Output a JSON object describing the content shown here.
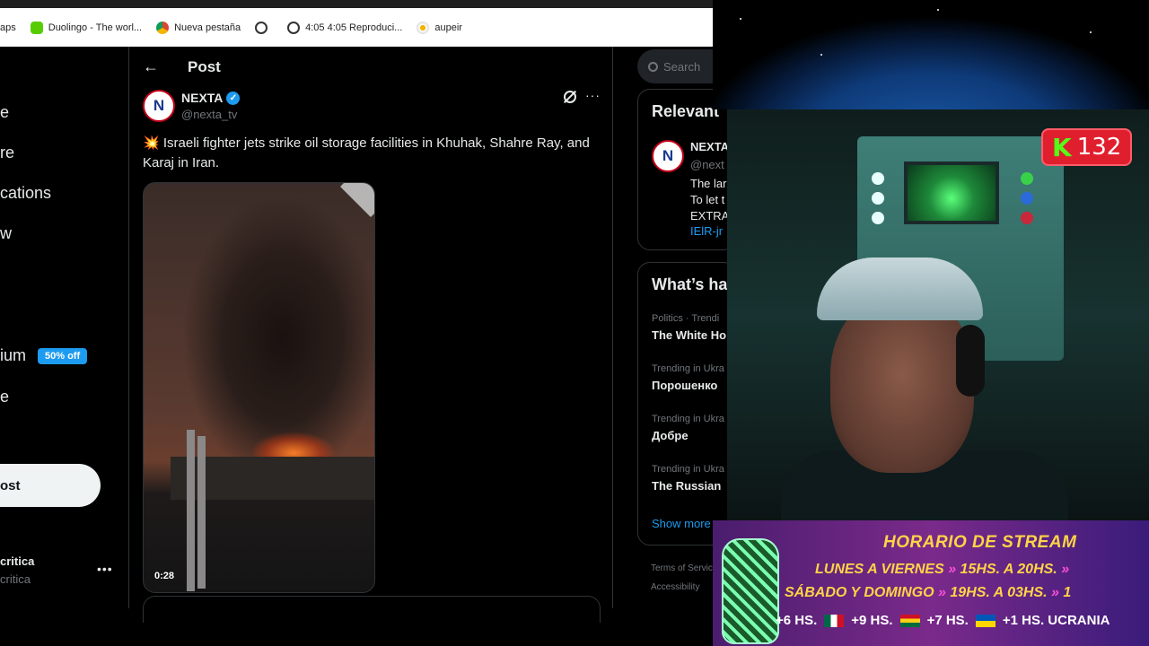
{
  "bookmarks": [
    {
      "label": "aps",
      "icon": "none"
    },
    {
      "label": "Duolingo - The worl...",
      "icon": "duolingo-icon"
    },
    {
      "label": "Nueva pestaña",
      "icon": "chrome-icon"
    },
    {
      "label": "",
      "icon": "globe-icon"
    },
    {
      "label": "4:05 4:05 Reproduci...",
      "icon": "globe-icon"
    },
    {
      "label": "aupeir",
      "icon": "aupeir-icon"
    }
  ],
  "nav": {
    "items": [
      "e",
      "re",
      "cations",
      "w",
      "ium",
      "e"
    ],
    "premium_badge": "50% off",
    "post_button": "ost",
    "account_name": "critica",
    "account_handle": "critica",
    "more": "•••"
  },
  "post_header": {
    "back": "←",
    "title": "Post"
  },
  "tweet": {
    "author_name": "NEXTA",
    "author_handle": "@nexta_tv",
    "avatar_letter": "N",
    "emoji": "💥",
    "text": "Israeli fighter jets strike oil storage facilities in Khuhak, Shahre Ray, and Karaj in Iran.",
    "video_duration": "0:28",
    "more": "···"
  },
  "search": {
    "placeholder": "Search"
  },
  "relevant": {
    "title": "Relevant",
    "name": "NEXTA",
    "handle": "@next",
    "lines": [
      "The lar",
      "To let t",
      "EXTRA"
    ],
    "link": "IElR-jr"
  },
  "trends": {
    "title": "What’s ha",
    "items": [
      {
        "meta": "Politics · Trendi",
        "name": "The White Ho"
      },
      {
        "meta": "Trending in Ukra",
        "name": "Порошенко"
      },
      {
        "meta": "Trending in Ukra",
        "name": "Добре"
      },
      {
        "meta": "Trending in Ukra",
        "name": "The Russian"
      }
    ],
    "show_more": "Show more"
  },
  "footer": {
    "terms": "Terms of Servic",
    "accessibility": "Accessibility"
  },
  "overlay": {
    "kick_logo": "K",
    "viewer_count": "132",
    "schedule_title": "HORARIO DE STREAM",
    "row1_days": "LUNES A VIERNES",
    "row1_hours": "15HS. A 20HS.",
    "row2_days": "SÁBADO Y DOMINGO",
    "row2_hours": "19HS. A 03HS.",
    "tz": [
      "+6 HS.",
      "+9 HS.",
      "+7 HS.",
      "+1 HS. UCRANIA"
    ],
    "edge_char": "1"
  },
  "colors": {
    "accent": "#1d9bf0",
    "background": "#000000",
    "kick_green": "#53fc18",
    "schedule_gold": "#ffd447"
  }
}
